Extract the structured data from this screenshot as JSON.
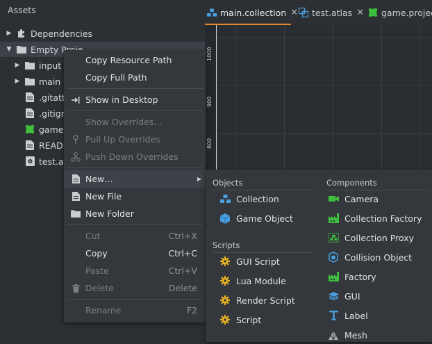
{
  "assets": {
    "title": "Assets",
    "rows": [
      {
        "label": "Dependencies"
      },
      {
        "label": "Empty Proje"
      },
      {
        "label": "input"
      },
      {
        "label": "main"
      },
      {
        "label": ".gitattr"
      },
      {
        "label": ".gitigno"
      },
      {
        "label": "game.p"
      },
      {
        "label": "READM"
      },
      {
        "label": "test.ap"
      }
    ]
  },
  "tabs": [
    {
      "label": "main.collection",
      "close": "✕"
    },
    {
      "label": "test.atlas",
      "close": "✕"
    },
    {
      "label": "game.project"
    }
  ],
  "ruler": {
    "labels": [
      "1000",
      "900",
      "800"
    ]
  },
  "context_menu": {
    "items": [
      {
        "label": "Copy Resource Path"
      },
      {
        "label": "Copy Full Path"
      },
      {
        "label": "Show in Desktop"
      },
      {
        "label": "Show Overrides…"
      },
      {
        "label": "Pull Up Overrides"
      },
      {
        "label": "Push Down Overrides"
      },
      {
        "label": "New…"
      },
      {
        "label": "New File"
      },
      {
        "label": "New Folder"
      },
      {
        "label": "Cut",
        "shortcut": "Ctrl+X"
      },
      {
        "label": "Copy",
        "shortcut": "Ctrl+C"
      },
      {
        "label": "Paste",
        "shortcut": "Ctrl+V"
      },
      {
        "label": "Delete",
        "shortcut": "Delete"
      },
      {
        "label": "Rename",
        "shortcut": "F2"
      }
    ]
  },
  "new_submenu": {
    "objects_header": "Objects",
    "objects": [
      {
        "label": "Collection"
      },
      {
        "label": "Game Object"
      }
    ],
    "scripts_header": "Scripts",
    "scripts": [
      {
        "label": "GUI Script"
      },
      {
        "label": "Lua Module"
      },
      {
        "label": "Render Script"
      },
      {
        "label": "Script"
      }
    ],
    "components_header": "Components",
    "components": [
      {
        "label": "Camera"
      },
      {
        "label": "Collection Factory"
      },
      {
        "label": "Collection Proxy"
      },
      {
        "label": "Collision Object"
      },
      {
        "label": "Factory"
      },
      {
        "label": "GUI"
      },
      {
        "label": "Label"
      },
      {
        "label": "Mesh"
      }
    ]
  },
  "colors": {
    "accent": "#e9842f",
    "blue_icon": "#4a9fe0",
    "green_icon": "#3fbf3f",
    "gold_icon": "#e8b323"
  }
}
